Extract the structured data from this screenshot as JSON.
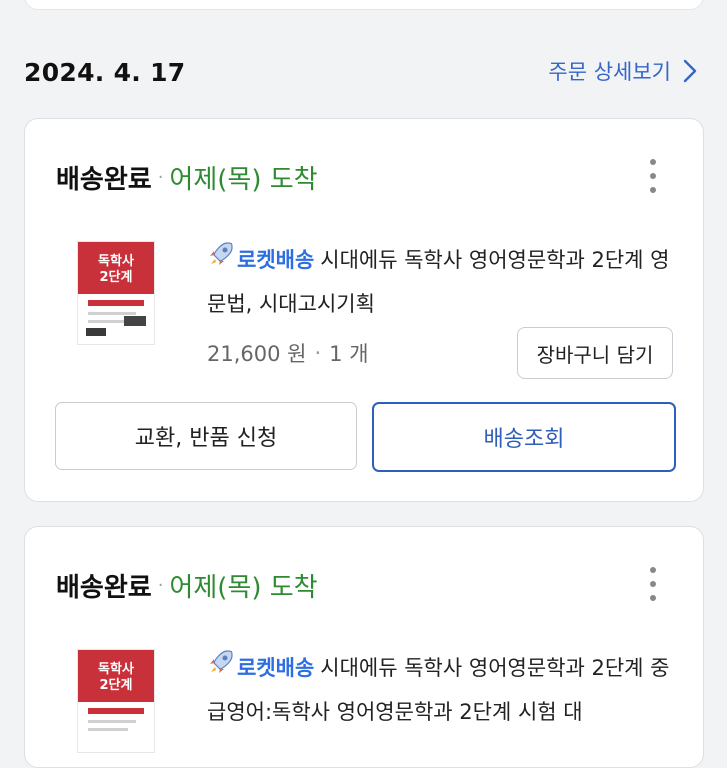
{
  "order": {
    "date": "2024. 4. 17",
    "detail_link": "주문 상세보기"
  },
  "items": [
    {
      "status": "배송완료",
      "arrival": "어제(목) 도착",
      "rocket_label": "로켓배송",
      "title": "시대에듀 독학사 영어영문학과 2단계 영문법, 시대고시기획",
      "price": "21,600 원",
      "quantity": "1 개",
      "cart_button": "장바구니 담기",
      "exchange_button": "교환, 반품 신청",
      "track_button": "배송조회",
      "cover": {
        "line1": "독학사",
        "line2": "2단계"
      }
    },
    {
      "status": "배송완료",
      "arrival": "어제(목) 도착",
      "rocket_label": "로켓배송",
      "title": "시대에듀 독학사 영어영문학과 2단계 중급영어:독학사 영어영문학과 2단계 시험 대",
      "cover": {
        "line1": "독학사",
        "line2": "2단계"
      }
    }
  ],
  "colors": {
    "accent_blue": "#3567c8",
    "arrival_green": "#2e8b32",
    "cover_red": "#c8303a"
  },
  "icons": {
    "more": "more-vertical-icon",
    "rocket": "rocket-icon",
    "chevron": "chevron-right-icon"
  }
}
